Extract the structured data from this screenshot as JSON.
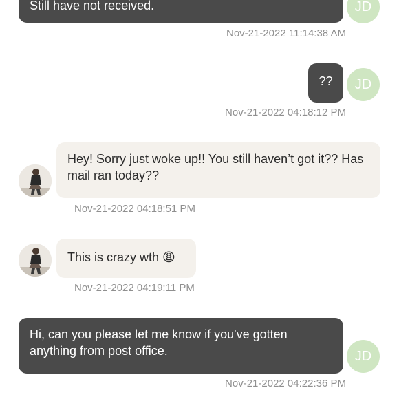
{
  "messages": [
    {
      "direction": "out",
      "text": "Still have not received.",
      "timestamp": "Nov-21-2022 11:14:38 AM",
      "avatar_initials": "JD"
    },
    {
      "direction": "out",
      "text": "??",
      "timestamp": "Nov-21-2022 04:18:12 PM",
      "avatar_initials": "JD"
    },
    {
      "direction": "in",
      "text": "Hey! Sorry just woke up!! You still haven’t got it?? Has mail ran today??",
      "timestamp": "Nov-21-2022 04:18:51 PM",
      "avatar": "contact-photo"
    },
    {
      "direction": "in",
      "text": "This is crazy wth 😩",
      "timestamp": "Nov-21-2022 04:19:11 PM",
      "avatar": "contact-photo"
    },
    {
      "direction": "out",
      "text": "Hi, can you please let me know if you've gotten anything from post office.",
      "timestamp": "Nov-21-2022 04:22:36 PM",
      "avatar_initials": "JD"
    }
  ],
  "colors": {
    "outgoing_bubble": "#4a4a4a",
    "incoming_bubble": "#f4f1ec",
    "my_avatar": "#cfe6c2",
    "timestamp_text": "#8f8f8f"
  }
}
